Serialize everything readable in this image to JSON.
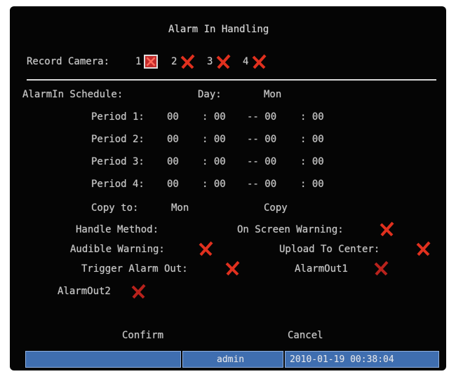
{
  "title": "Alarm In Handling",
  "record_camera": {
    "label": "Record Camera:",
    "cameras": [
      {
        "number": "1",
        "state": "selected-cross"
      },
      {
        "number": "2",
        "state": "cross"
      },
      {
        "number": "3",
        "state": "cross"
      },
      {
        "number": "4",
        "state": "cross"
      }
    ]
  },
  "schedule": {
    "label": "AlarmIn Schedule:",
    "day_label": "Day:",
    "day_value": "Mon",
    "periods": [
      {
        "label": "Period 1:",
        "start_h": "00",
        "start_m": ": 00",
        "end_h": "-- 00",
        "end_m": ": 00"
      },
      {
        "label": "Period 2:",
        "start_h": "00",
        "start_m": ": 00",
        "end_h": "-- 00",
        "end_m": ": 00"
      },
      {
        "label": "Period 3:",
        "start_h": "00",
        "start_m": ": 00",
        "end_h": "-- 00",
        "end_m": ": 00"
      },
      {
        "label": "Period 4:",
        "start_h": "00",
        "start_m": ": 00",
        "end_h": "-- 00",
        "end_m": ": 00"
      }
    ]
  },
  "copy": {
    "label": "Copy to:",
    "value": "Mon",
    "button": "Copy"
  },
  "handle": {
    "label": "Handle Method:",
    "on_screen_warning": "On Screen Warning:",
    "audible_warning": "Audible Warning:",
    "upload_to_center": "Upload To Center:",
    "trigger_alarm_out": "Trigger Alarm Out:",
    "alarm_out_1": "AlarmOut1",
    "alarm_out_2": "AlarmOut2"
  },
  "buttons": {
    "confirm": "Confirm",
    "cancel": "Cancel"
  },
  "status_bar": {
    "user": "admin",
    "datetime": "2010-01-19 00:38:04"
  },
  "colors": {
    "background": "#050505",
    "text": "#c9c9c9",
    "cross": "#e0301e",
    "status_bar": "#3f6eb0"
  }
}
